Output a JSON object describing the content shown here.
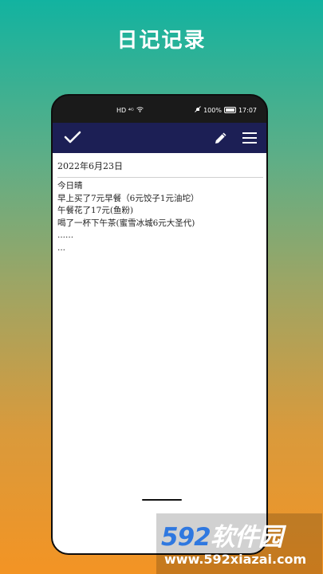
{
  "headline": "日记记录",
  "status_bar": {
    "left_icons": "HD ⁴ᴳ",
    "battery_percent": "100%",
    "time": "17:07"
  },
  "toolbar": {
    "confirm_icon": "check-icon",
    "edit_icon": "pencil-icon",
    "menu_icon": "menu-icon",
    "bar_color": "#1c1f55"
  },
  "diary": {
    "date": "2022年6月23日",
    "lines": [
      "今日晴",
      "早上买了7元早餐（6元饺子1元油坨）",
      "午餐花了17元(鱼粉)",
      "喝了一杯下午茶(蜜雪冰城6元大圣代)",
      "......",
      "..."
    ]
  },
  "watermark": {
    "logo_number": "592",
    "logo_text": "软件园",
    "url": "www.592xiazai.com"
  }
}
